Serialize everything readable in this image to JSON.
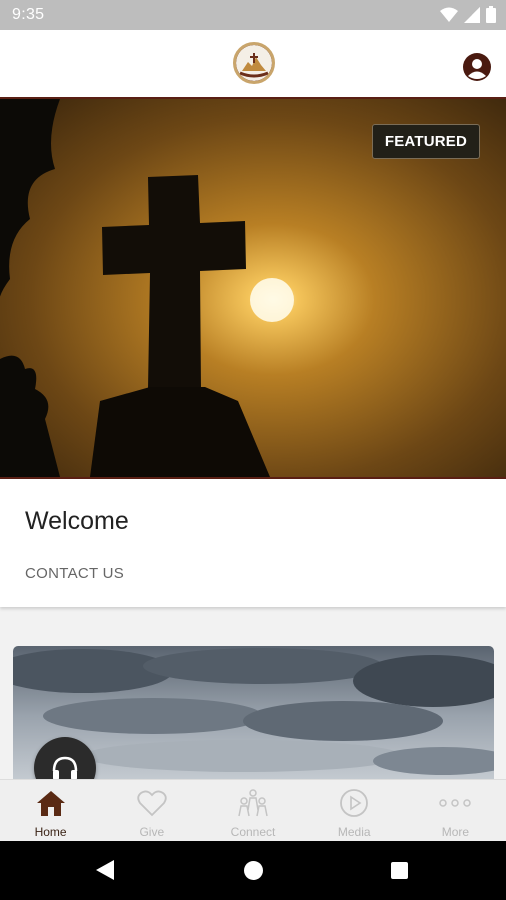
{
  "status_bar": {
    "time": "9:35"
  },
  "app_bar": {
    "logo_icon": "church-logo-icon",
    "profile_icon": "account-circle-icon",
    "accent_color": "#5a1f14"
  },
  "hero": {
    "badge": "FEATURED",
    "image": "cross-sunset-image"
  },
  "welcome_card": {
    "title": "Welcome",
    "link": "CONTACT US"
  },
  "media_card": {
    "image": "cloudy-sky-image",
    "fab_icon": "headphones-icon"
  },
  "bottom_nav": {
    "items": [
      {
        "label": "Home",
        "icon": "home-icon",
        "active": true
      },
      {
        "label": "Give",
        "icon": "heart-icon",
        "active": false
      },
      {
        "label": "Connect",
        "icon": "people-icon",
        "active": false
      },
      {
        "label": "Media",
        "icon": "play-circle-icon",
        "active": false
      },
      {
        "label": "More",
        "icon": "more-dots-icon",
        "active": false
      }
    ]
  }
}
